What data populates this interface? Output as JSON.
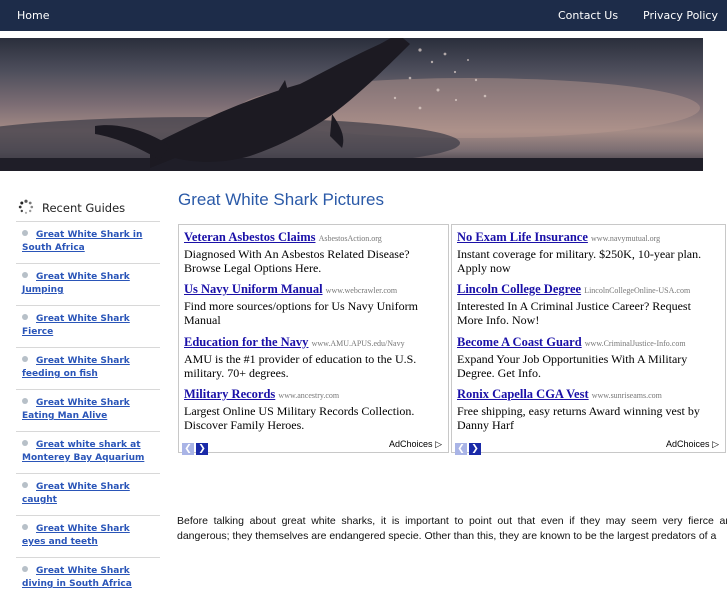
{
  "nav": {
    "home": "Home",
    "contact": "Contact Us",
    "privacy": "Privacy Policy"
  },
  "sidebar": {
    "title": "Recent Guides",
    "icon": "spinner-icon",
    "items": [
      {
        "label": "Great White Shark in South Africa"
      },
      {
        "label": "Great White Shark Jumping"
      },
      {
        "label": "Great White Shark Fierce"
      },
      {
        "label": "Great White Shark feeding on fish"
      },
      {
        "label": "Great White Shark Eating Man Alive"
      },
      {
        "label": "Great white shark at Monterey Bay Aquarium"
      },
      {
        "label": "Great White Shark caught"
      },
      {
        "label": "Great White Shark eyes and teeth"
      },
      {
        "label": "Great White Shark diving in South Africa"
      }
    ]
  },
  "main": {
    "title": "Great White Shark Pictures",
    "body": "Before talking about great white sharks, it is important to point out that even if they may seem very fierce and dangerous; they themselves are endangered specie. Other than this, they are known to be the largest predators of a"
  },
  "ads": {
    "adchoices": "AdChoices",
    "left": [
      {
        "title": "Veteran Asbestos Claims",
        "url": "AsbestosAction.org",
        "desc": "Diagnosed With An Asbestos Related Disease? Browse Legal Options Here."
      },
      {
        "title": "Us Navy Uniform Manual",
        "url": "www.webcrawler.com",
        "desc": "Find more sources/options for Us Navy Uniform Manual"
      },
      {
        "title": "Education for the Navy",
        "url": "www.AMU.APUS.edu/Navy",
        "desc": "AMU is the #1 provider of education to the U.S. military. 70+ degrees."
      },
      {
        "title": "Military Records",
        "url": "www.ancestry.com",
        "desc": "Largest Online US Military Records Collection. Discover Family Heroes."
      }
    ],
    "right": [
      {
        "title": "No Exam Life Insurance",
        "url": "www.navymutual.org",
        "desc": "Instant coverage for military. $250K, 10-year plan. Apply now"
      },
      {
        "title": "Lincoln College Degree",
        "url": "LincolnCollegeOnline-USA.com",
        "desc": "Interested In A Criminal Justice Career? Request More Info. Now!"
      },
      {
        "title": "Become A Coast Guard",
        "url": "www.CriminalJustice-Info.com",
        "desc": "Expand Your Job Opportunities With A Military Degree. Get Info."
      },
      {
        "title": "Ronix Capella CGA Vest",
        "url": "www.sunriseams.com",
        "desc": "Free shipping, easy returns Award winning vest by Danny Harf"
      }
    ]
  }
}
